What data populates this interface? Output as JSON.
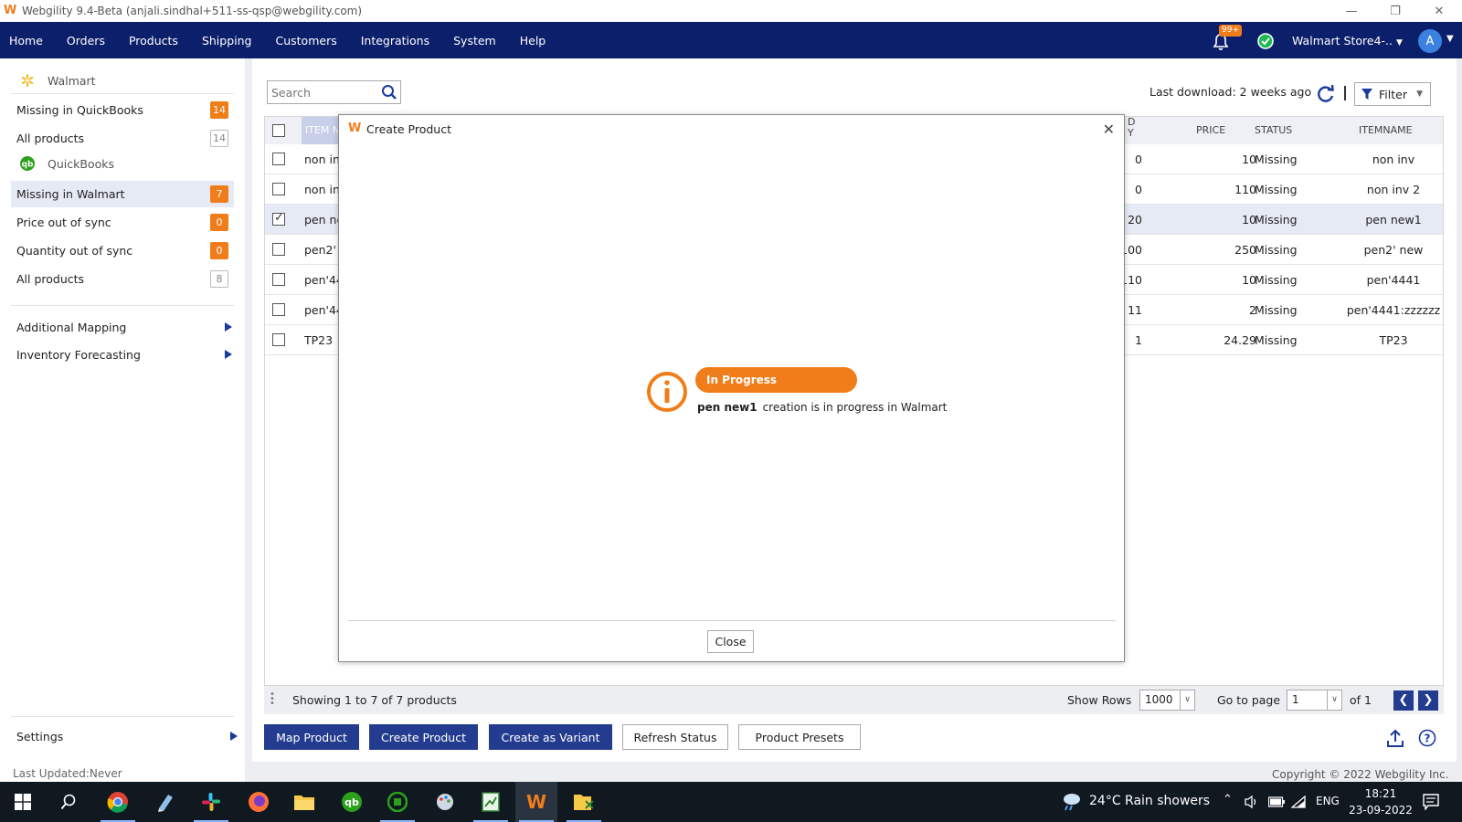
{
  "window": {
    "title": "Webgility 9.4-Beta (anjali.sindhal+511-ss-qsp@webgility.com)"
  },
  "menu": {
    "items": [
      "Home",
      "Orders",
      "Products",
      "Shipping",
      "Customers",
      "Integrations",
      "System",
      "Help"
    ],
    "notification_count": "99+",
    "store": "Walmart Store4-..",
    "avatar_initial": "A"
  },
  "sidebar": {
    "walmart_section": "Walmart",
    "walmart_items": [
      {
        "label": "Missing in QuickBooks",
        "count": "14"
      },
      {
        "label": "All products",
        "count": "14"
      }
    ],
    "qb_section": "QuickBooks",
    "qb_items": [
      {
        "label": "Missing in Walmart",
        "count": "7"
      },
      {
        "label": "Price out of sync",
        "count": "0"
      },
      {
        "label": "Quantity out of sync",
        "count": "0"
      },
      {
        "label": "All products",
        "count": "8"
      }
    ],
    "additional_mapping": "Additional Mapping",
    "inventory_forecasting": "Inventory Forecasting",
    "settings": "Settings",
    "last_updated": "Last Updated:Never"
  },
  "toolbar": {
    "search_placeholder": "Search",
    "last_download": "Last download: 2 weeks ago",
    "filter_label": "Filter"
  },
  "grid": {
    "headers": {
      "item": "ITEM N",
      "qty_top": "D",
      "qty_bottom": "Y",
      "price": "PRICE",
      "status": "STATUS",
      "itemname": "ITEMNAME"
    },
    "rows": [
      {
        "item": "non in",
        "qty": "0",
        "price": "10",
        "status": "Missing",
        "itemname": "non inv",
        "checked": false
      },
      {
        "item": "non in",
        "qty": "0",
        "price": "110",
        "status": "Missing",
        "itemname": "non inv 2",
        "checked": false
      },
      {
        "item": "pen ne",
        "qty": "20",
        "price": "10",
        "status": "Missing",
        "itemname": "pen new1",
        "checked": true
      },
      {
        "item": "pen2' ",
        "qty": "100",
        "price": "250",
        "status": "Missing",
        "itemname": "pen2' new",
        "checked": false
      },
      {
        "item": "pen'44",
        "qty": "110",
        "price": "10",
        "status": "Missing",
        "itemname": "pen'4441",
        "checked": false
      },
      {
        "item": "pen'44",
        "qty": "11",
        "price": "2",
        "status": "Missing",
        "itemname": "pen'4441:zzzzzz",
        "checked": false
      },
      {
        "item": "TP23",
        "qty": "1",
        "price": "24.29",
        "status": "Missing",
        "itemname": "TP23",
        "checked": false
      }
    ]
  },
  "footer": {
    "showing": "Showing 1 to 7 of 7 products",
    "show_rows_label": "Show Rows",
    "show_rows_value": "1000",
    "go_to_page_label": "Go to page",
    "page_value": "1",
    "of_pages": "of 1"
  },
  "actions": {
    "map_product": "Map Product",
    "create_product": "Create Product",
    "create_as_variant": "Create as Variant",
    "refresh_status": "Refresh Status",
    "product_presets": "Product Presets"
  },
  "copyright": "Copyright © 2022 Webgility Inc.",
  "modal": {
    "title": "Create Product",
    "status_pill": "In Progress",
    "product_name": "pen new1",
    "message": "creation is in progress in Walmart",
    "close_label": "Close"
  },
  "taskbar": {
    "weather": "24°C  Rain showers",
    "language": "ENG",
    "time": "18:21",
    "date": "23-09-2022"
  },
  "colors": {
    "nav_blue": "#0c1f6b",
    "accent_orange": "#f07d1a",
    "button_blue": "#243c8f"
  }
}
